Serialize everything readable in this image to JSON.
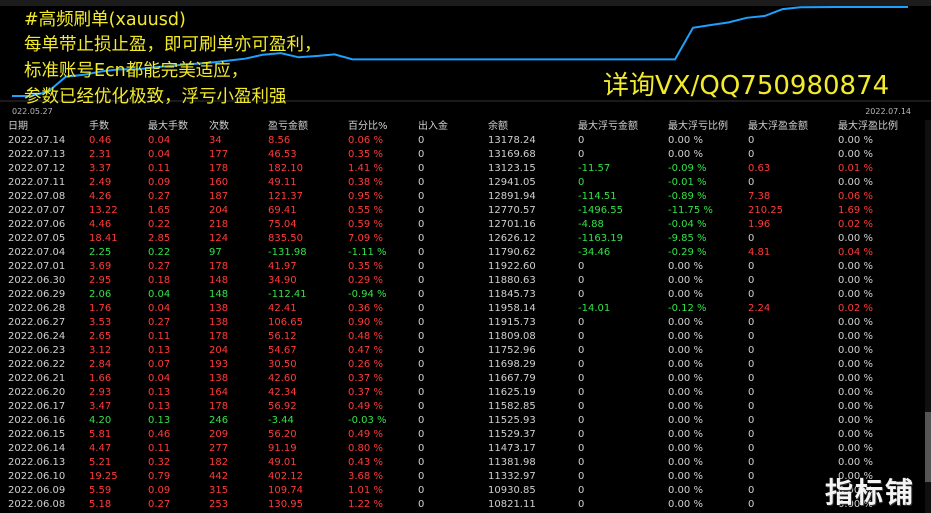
{
  "colors": {
    "promo_text": "#f2ea2a",
    "equity_line": "#1ea0ff",
    "profit": "#ff3b3b",
    "loss": "#35e04a",
    "neutral": "#d0d0d0",
    "background": "#000000"
  },
  "chart": {
    "date_start": "022.05.27",
    "date_end": "2022.07.14",
    "equity_points": [
      [
        0.0,
        10821.11
      ],
      [
        0.02,
        10821.11
      ],
      [
        0.04,
        10930.85
      ],
      [
        0.06,
        11332.97
      ],
      [
        0.08,
        11381.98
      ],
      [
        0.1,
        11473.17
      ],
      [
        0.12,
        11529.37
      ],
      [
        0.14,
        11525.93
      ],
      [
        0.16,
        11582.85
      ],
      [
        0.18,
        11625.19
      ],
      [
        0.2,
        11667.79
      ],
      [
        0.22,
        11698.29
      ],
      [
        0.24,
        11752.96
      ],
      [
        0.26,
        11809.08
      ],
      [
        0.28,
        11915.73
      ],
      [
        0.3,
        11958.14
      ],
      [
        0.32,
        11845.73
      ],
      [
        0.34,
        11880.63
      ],
      [
        0.36,
        11922.6
      ],
      [
        0.38,
        11790.62
      ],
      [
        0.41,
        11790.62
      ],
      [
        0.44,
        11790.62
      ],
      [
        0.47,
        11790.62
      ],
      [
        0.5,
        11790.62
      ],
      [
        0.53,
        11790.62
      ],
      [
        0.56,
        11790.62
      ],
      [
        0.59,
        11790.62
      ],
      [
        0.62,
        11790.62
      ],
      [
        0.65,
        11790.62
      ],
      [
        0.68,
        11790.62
      ],
      [
        0.72,
        11790.62
      ],
      [
        0.74,
        11790.62
      ],
      [
        0.76,
        12626.12
      ],
      [
        0.78,
        12701.16
      ],
      [
        0.8,
        12770.57
      ],
      [
        0.82,
        12891.94
      ],
      [
        0.84,
        12941.05
      ],
      [
        0.86,
        13123.15
      ],
      [
        0.88,
        13169.68
      ],
      [
        0.92,
        13178.24
      ],
      [
        1.0,
        13178.24
      ]
    ]
  },
  "promo": {
    "line1": "#高频刷单(xauusd)",
    "line2": "每单带止损止盈，即可刷单亦可盈利，",
    "line3": "标准账号Ecn都能完美适应，",
    "line4": "参数已经优化极致，浮亏小盈利强",
    "contact": "详询VX/QQ750980874"
  },
  "table": {
    "headers": [
      "日期",
      "手数",
      "最大手数",
      "次数",
      "盈亏金额",
      "百分比%",
      "出入金",
      "余额",
      "最大浮亏金额",
      "最大浮亏比例",
      "最大浮盈金额",
      "最大浮盈比例"
    ],
    "rows": [
      {
        "cells": [
          "2022.07.14",
          "0.46",
          "0.04",
          "34",
          "8.56",
          "0.06 %",
          "0",
          "13178.24",
          "0",
          "0.00 %",
          "0",
          "0.00 %"
        ],
        "sign": "pos",
        "fp": false,
        "fl": false
      },
      {
        "cells": [
          "2022.07.13",
          "2.31",
          "0.04",
          "177",
          "46.53",
          "0.35 %",
          "0",
          "13169.68",
          "0",
          "0.00 %",
          "0",
          "0.00 %"
        ],
        "sign": "pos",
        "fp": false,
        "fl": false
      },
      {
        "cells": [
          "2022.07.12",
          "3.37",
          "0.11",
          "178",
          "182.10",
          "1.41 %",
          "0",
          "13123.15",
          "-11.57",
          "-0.09 %",
          "0.63",
          "0.01 %"
        ],
        "sign": "pos",
        "fp": true,
        "fl": true
      },
      {
        "cells": [
          "2022.07.11",
          "2.49",
          "0.09",
          "160",
          "49.11",
          "0.38 %",
          "0",
          "12941.05",
          "0",
          "-0.01 %",
          "0",
          "0.00 %"
        ],
        "sign": "pos",
        "fp": false,
        "fl": true
      },
      {
        "cells": [
          "2022.07.08",
          "4.26",
          "0.27",
          "187",
          "121.37",
          "0.95 %",
          "0",
          "12891.94",
          "-114.51",
          "-0.89 %",
          "7.38",
          "0.06 %"
        ],
        "sign": "pos",
        "fp": true,
        "fl": true
      },
      {
        "cells": [
          "2022.07.07",
          "13.22",
          "1.65",
          "204",
          "69.41",
          "0.55 %",
          "0",
          "12770.57",
          "-1496.55",
          "-11.75 %",
          "210.25",
          "1.69 %"
        ],
        "sign": "pos",
        "fp": true,
        "fl": true
      },
      {
        "cells": [
          "2022.07.06",
          "4.46",
          "0.22",
          "218",
          "75.04",
          "0.59 %",
          "0",
          "12701.16",
          "-4.88",
          "-0.04 %",
          "1.96",
          "0.02 %"
        ],
        "sign": "pos",
        "fp": true,
        "fl": true
      },
      {
        "cells": [
          "2022.07.05",
          "18.41",
          "2.85",
          "124",
          "835.50",
          "7.09 %",
          "0",
          "12626.12",
          "-1163.19",
          "-9.85 %",
          "0",
          "0.00 %"
        ],
        "sign": "pos",
        "fp": false,
        "fl": true
      },
      {
        "cells": [
          "2022.07.04",
          "2.25",
          "0.22",
          "97",
          "-131.98",
          "-1.11 %",
          "0",
          "11790.62",
          "-34.46",
          "-0.29 %",
          "4.81",
          "0.04 %"
        ],
        "sign": "neg",
        "fp": true,
        "fl": true
      },
      {
        "cells": [
          "2022.07.01",
          "3.69",
          "0.27",
          "178",
          "41.97",
          "0.35 %",
          "0",
          "11922.60",
          "0",
          "0.00 %",
          "0",
          "0.00 %"
        ],
        "sign": "pos",
        "fp": false,
        "fl": false
      },
      {
        "cells": [
          "2022.06.30",
          "2.95",
          "0.18",
          "148",
          "34.90",
          "0.29 %",
          "0",
          "11880.63",
          "0",
          "0.00 %",
          "0",
          "0.00 %"
        ],
        "sign": "pos",
        "fp": false,
        "fl": false
      },
      {
        "cells": [
          "2022.06.29",
          "2.06",
          "0.04",
          "148",
          "-112.41",
          "-0.94 %",
          "0",
          "11845.73",
          "0",
          "0.00 %",
          "0",
          "0.00 %"
        ],
        "sign": "neg",
        "fp": false,
        "fl": false
      },
      {
        "cells": [
          "2022.06.28",
          "1.76",
          "0.04",
          "138",
          "42.41",
          "0.36 %",
          "0",
          "11958.14",
          "-14.01",
          "-0.12 %",
          "2.24",
          "0.02 %"
        ],
        "sign": "pos",
        "fp": true,
        "fl": true
      },
      {
        "cells": [
          "2022.06.27",
          "3.53",
          "0.27",
          "138",
          "106.65",
          "0.90 %",
          "0",
          "11915.73",
          "0",
          "0.00 %",
          "0",
          "0.00 %"
        ],
        "sign": "pos",
        "fp": false,
        "fl": false
      },
      {
        "cells": [
          "2022.06.24",
          "2.65",
          "0.11",
          "178",
          "56.12",
          "0.48 %",
          "0",
          "11809.08",
          "0",
          "0.00 %",
          "0",
          "0.00 %"
        ],
        "sign": "pos",
        "fp": false,
        "fl": false
      },
      {
        "cells": [
          "2022.06.23",
          "3.12",
          "0.13",
          "204",
          "54.67",
          "0.47 %",
          "0",
          "11752.96",
          "0",
          "0.00 %",
          "0",
          "0.00 %"
        ],
        "sign": "pos",
        "fp": false,
        "fl": false
      },
      {
        "cells": [
          "2022.06.22",
          "2.84",
          "0.07",
          "193",
          "30.50",
          "0.26 %",
          "0",
          "11698.29",
          "0",
          "0.00 %",
          "0",
          "0.00 %"
        ],
        "sign": "pos",
        "fp": false,
        "fl": false
      },
      {
        "cells": [
          "2022.06.21",
          "1.66",
          "0.04",
          "138",
          "42.60",
          "0.37 %",
          "0",
          "11667.79",
          "0",
          "0.00 %",
          "0",
          "0.00 %"
        ],
        "sign": "pos",
        "fp": false,
        "fl": false
      },
      {
        "cells": [
          "2022.06.20",
          "2.93",
          "0.13",
          "164",
          "42.34",
          "0.37 %",
          "0",
          "11625.19",
          "0",
          "0.00 %",
          "0",
          "0.00 %"
        ],
        "sign": "pos",
        "fp": false,
        "fl": false
      },
      {
        "cells": [
          "2022.06.17",
          "3.47",
          "0.13",
          "178",
          "56.92",
          "0.49 %",
          "0",
          "11582.85",
          "0",
          "0.00 %",
          "0",
          "0.00 %"
        ],
        "sign": "pos",
        "fp": false,
        "fl": false
      },
      {
        "cells": [
          "2022.06.16",
          "4.20",
          "0.13",
          "246",
          "-3.44",
          "-0.03 %",
          "0",
          "11525.93",
          "0",
          "0.00 %",
          "0",
          "0.00 %"
        ],
        "sign": "neg",
        "fp": false,
        "fl": false
      },
      {
        "cells": [
          "2022.06.15",
          "5.81",
          "0.46",
          "209",
          "56.20",
          "0.49 %",
          "0",
          "11529.37",
          "0",
          "0.00 %",
          "0",
          "0.00 %"
        ],
        "sign": "pos",
        "fp": false,
        "fl": false
      },
      {
        "cells": [
          "2022.06.14",
          "4.47",
          "0.11",
          "277",
          "91.19",
          "0.80 %",
          "0",
          "11473.17",
          "0",
          "0.00 %",
          "0",
          "0.00 %"
        ],
        "sign": "pos",
        "fp": false,
        "fl": false
      },
      {
        "cells": [
          "2022.06.13",
          "5.21",
          "0.32",
          "182",
          "49.01",
          "0.43 %",
          "0",
          "11381.98",
          "0",
          "0.00 %",
          "0",
          "0.00 %"
        ],
        "sign": "pos",
        "fp": false,
        "fl": false
      },
      {
        "cells": [
          "2022.06.10",
          "19.25",
          "0.79",
          "442",
          "402.12",
          "3.68 %",
          "0",
          "11332.97",
          "0",
          "0.00 %",
          "0",
          "0.00 %"
        ],
        "sign": "pos",
        "fp": false,
        "fl": false
      },
      {
        "cells": [
          "2022.06.09",
          "5.59",
          "0.09",
          "315",
          "109.74",
          "1.01 %",
          "0",
          "10930.85",
          "0",
          "0.00 %",
          "0",
          "0.00 %"
        ],
        "sign": "pos",
        "fp": false,
        "fl": false
      },
      {
        "cells": [
          "2022.06.08",
          "5.18",
          "0.27",
          "253",
          "130.95",
          "1.22 %",
          "0",
          "10821.11",
          "0",
          "0.00 %",
          "0",
          "0.00 %"
        ],
        "sign": "pos",
        "fp": false,
        "fl": false
      }
    ]
  },
  "watermark": "指标铺"
}
